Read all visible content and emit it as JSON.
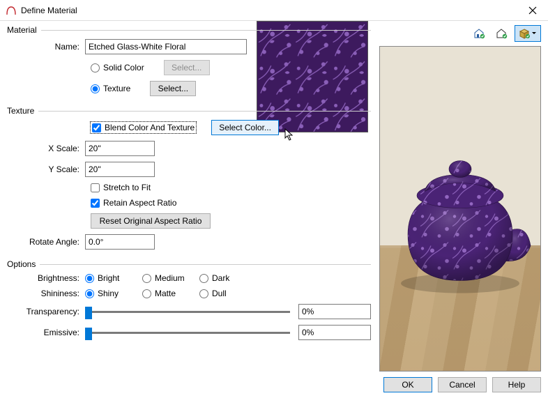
{
  "window": {
    "title": "Define Material"
  },
  "material": {
    "group_label": "Material",
    "name_label": "Name:",
    "name_value": "Etched Glass-White Floral",
    "solid_color_label": "Solid Color",
    "texture_label": "Texture",
    "select_btn": "Select...",
    "mode": "texture"
  },
  "texture": {
    "group_label": "Texture",
    "blend_label": "Blend Color And Texture",
    "blend_checked": true,
    "select_color_btn": "Select Color...",
    "x_scale_label": "X Scale:",
    "x_scale_value": "20\"",
    "y_scale_label": "Y Scale:",
    "y_scale_value": "20\"",
    "stretch_label": "Stretch to Fit",
    "stretch_checked": false,
    "retain_label": "Retain Aspect Ratio",
    "retain_checked": true,
    "reset_btn": "Reset Original Aspect Ratio",
    "rotate_label": "Rotate Angle:",
    "rotate_value": "0.0°"
  },
  "options": {
    "group_label": "Options",
    "brightness_label": "Brightness:",
    "brightness_choices": [
      "Bright",
      "Medium",
      "Dark"
    ],
    "brightness_selected": "Bright",
    "shininess_label": "Shininess:",
    "shininess_choices": [
      "Shiny",
      "Matte",
      "Dull"
    ],
    "shininess_selected": "Shiny",
    "transparency_label": "Transparency:",
    "transparency_value": "0%",
    "emissive_label": "Emissive:",
    "emissive_value": "0%"
  },
  "preview": {
    "toolbar": {
      "icon1": "house-check",
      "icon2": "house-check-outline",
      "icon3": "cube-check-dropdown"
    }
  },
  "buttons": {
    "ok": "OK",
    "cancel": "Cancel",
    "help": "Help"
  },
  "swatch_color": "#5e3a8a"
}
